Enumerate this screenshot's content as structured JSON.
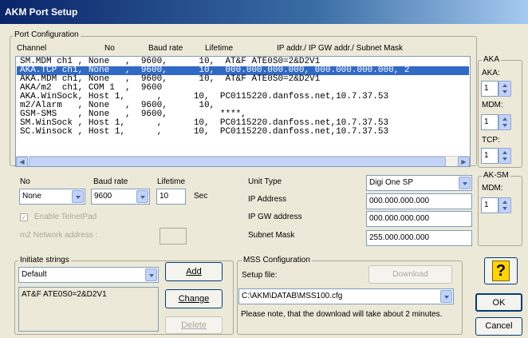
{
  "window": {
    "title": "AKM Port Setup"
  },
  "port_config": {
    "legend": "Port Configuration",
    "headers": {
      "channel": "Channel",
      "no": "No",
      "baud": "Baud rate",
      "lifetime": "Lifetime",
      "ip": "IP addr./ IP GW addr./ Subnet Mask"
    },
    "rows": [
      "SM.MDM ch1 , None   ,  9600,      10,  AT&F ATE0S0=2&D2V1",
      "AKA.TCP ch1, None   ,  9600,      10,  000.000.000.000, 000.000.000.000, 2",
      "AKA.MDM ch1, None   ,  9600,      10,  AT&F ATE0S0=2&D2V1",
      "AKA/m2  ch1, COM 1  ,  9600",
      "AKA.WinSock, Host 1,      ,      10,  PC0115220.danfoss.net,10.7.37.53",
      "m2/Alarm   , None   ,  9600,      10,",
      "GSM-SMS    , None   ,  9600,          ****,",
      "SM.WinSock , Host 1,      ,      10,  PC0115220.danfoss.net,10.7.37.53",
      "SC.Winsock , Host 1,      ,      10,  PC0115220.danfoss.net,10.7.37.53"
    ],
    "selected_index": 1
  },
  "aka": {
    "legend": "AKA",
    "aka_label": "AKA:",
    "aka_value": "1",
    "mdm_label": "MDM:",
    "mdm_value": "1",
    "tcp_label": "TCP:",
    "tcp_value": "1"
  },
  "aksm": {
    "legend": "AK-SM",
    "mdm_label": "MDM:",
    "mdm_value": "1"
  },
  "edit": {
    "no_label": "No",
    "no_value": "None",
    "baud_label": "Baud rate",
    "baud_value": "9600",
    "lifetime_label": "Lifetime",
    "lifetime_value": "10",
    "sec_label": "Sec",
    "telnetpad_label": "Enable TelnetPad",
    "m2_label": "m2 Network address :",
    "m2_value": "",
    "unit_type_label": "Unit Type",
    "unit_type_value": "Digi One SP",
    "ip_label": "IP Address",
    "ip_value": "000.000.000.000",
    "gw_label": "IP GW address",
    "gw_value": "000.000.000.000",
    "mask_label": "Subnet Mask",
    "mask_value": "255.000.000.000"
  },
  "initiate": {
    "legend": "Initiate strings",
    "combo_value": "Default",
    "text": "AT&F ATE0S0=2&D2V1",
    "add_label": "Add",
    "change_label": "Change",
    "delete_label": "Delete"
  },
  "mss": {
    "legend": "MSS Configuration",
    "setup_label": "Setup file:",
    "download_label": "Download",
    "path_value": "C:\\AKM\\DATAB\\MSS100.cfg",
    "note": "Please note, that the download will take about 2 minutes."
  },
  "buttons": {
    "help_glyph": "?",
    "ok_label": "OK",
    "cancel_label": "Cancel"
  }
}
